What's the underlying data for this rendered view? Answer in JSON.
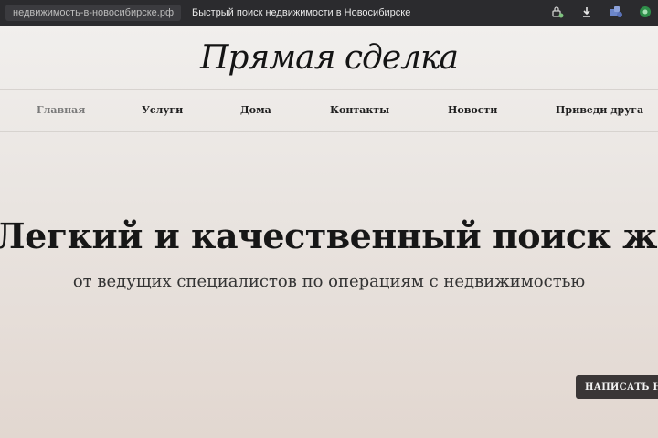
{
  "browser": {
    "url": "недвижимость-в-новосибирске.рф",
    "title": "Быстрый поиск недвижимости в Новосибирске",
    "icons": [
      "tracking-shield-icon",
      "download-icon",
      "extension-icon",
      "vpn-icon"
    ]
  },
  "site": {
    "logo": "Прямая сделка",
    "nav": [
      {
        "label": "Главная",
        "active": true
      },
      {
        "label": "Услуги"
      },
      {
        "label": "Дома"
      },
      {
        "label": "Контакты"
      },
      {
        "label": "Новости"
      },
      {
        "label": "Приведи друга"
      }
    ],
    "hero": {
      "title": "Легкий и качественный поиск жилья",
      "subtitle": "от ведущих специалистов по операциям с недвижимостью"
    },
    "cta_button": "НАПИСАТЬ НАМ"
  },
  "colors": {
    "browser_bar": "#2b2b2e",
    "nav_active": "#7a7a7a",
    "button_bg": "#3a3636"
  }
}
